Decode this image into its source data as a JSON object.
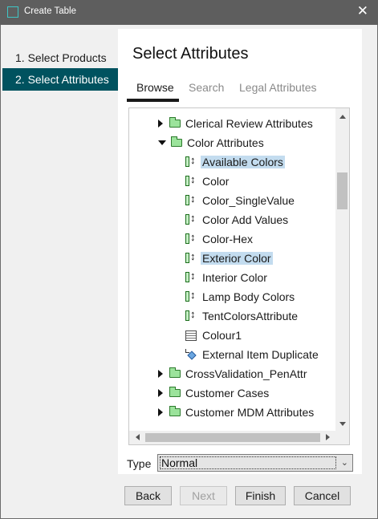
{
  "window": {
    "title": "Create Table",
    "close_glyph": "✕"
  },
  "steps": [
    {
      "label": "1. Select Products",
      "active": false
    },
    {
      "label": "2. Select Attributes",
      "active": true
    }
  ],
  "main": {
    "heading": "Select Attributes",
    "tabs": [
      {
        "label": "Browse",
        "active": true
      },
      {
        "label": "Search",
        "active": false
      },
      {
        "label": "Legal Attributes",
        "active": false
      }
    ]
  },
  "tree": {
    "rows": [
      {
        "label": "Clerical Review Attributes",
        "icon": "folder-icon",
        "expander": "collapsed",
        "selected": false
      },
      {
        "label": "Color Attributes",
        "icon": "folder-icon",
        "expander": "expanded",
        "selected": false
      },
      {
        "label": "Available Colors",
        "icon": "attribute-icon",
        "expander": "none",
        "selected": true
      },
      {
        "label": "Color",
        "icon": "attribute-icon",
        "expander": "none",
        "selected": false
      },
      {
        "label": "Color_SingleValue",
        "icon": "attribute-icon",
        "expander": "none",
        "selected": false
      },
      {
        "label": "Color Add Values",
        "icon": "attribute-icon",
        "expander": "none",
        "selected": false
      },
      {
        "label": "Color-Hex",
        "icon": "attribute-icon",
        "expander": "none",
        "selected": false
      },
      {
        "label": "Exterior Color",
        "icon": "attribute-icon",
        "expander": "none",
        "selected": true
      },
      {
        "label": "Interior Color",
        "icon": "attribute-icon",
        "expander": "none",
        "selected": false
      },
      {
        "label": "Lamp Body Colors",
        "icon": "attribute-icon",
        "expander": "none",
        "selected": false
      },
      {
        "label": "TentColorsAttribute",
        "icon": "attribute-icon",
        "expander": "none",
        "selected": false
      },
      {
        "label": "Colour1",
        "icon": "table-icon",
        "expander": "none",
        "selected": false
      },
      {
        "label": "External Item Duplicate",
        "icon": "reference-icon",
        "expander": "none",
        "selected": false
      },
      {
        "label": "CrossValidation_PenAttr",
        "icon": "folder-icon",
        "expander": "collapsed",
        "selected": false
      },
      {
        "label": "Customer Cases",
        "icon": "folder-icon",
        "expander": "collapsed",
        "selected": false
      },
      {
        "label": "Customer MDM Attributes",
        "icon": "folder-icon",
        "expander": "collapsed",
        "selected": false
      }
    ]
  },
  "type_field": {
    "label": "Type",
    "value": "Normal",
    "chevron": "⌄"
  },
  "buttons": {
    "back": "Back",
    "next": "Next",
    "finish": "Finish",
    "cancel": "Cancel"
  },
  "colors": {
    "accent": "#00525f",
    "selection": "#c3dcef",
    "titlebar": "#5e5e5e"
  }
}
